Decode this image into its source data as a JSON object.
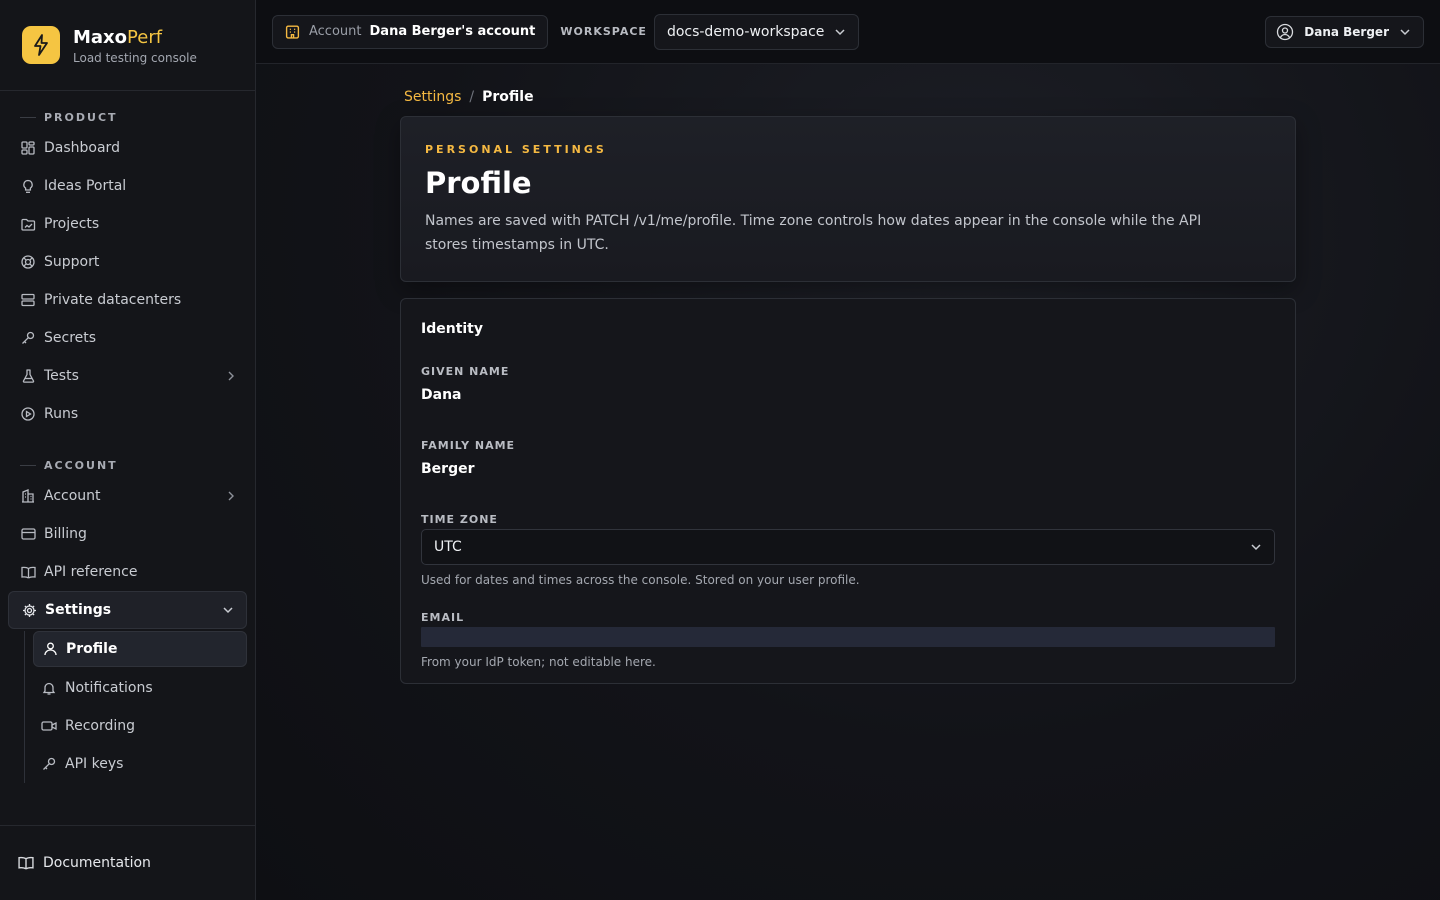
{
  "brand": {
    "name_main": "Maxo",
    "name_accent": "Perf",
    "subtitle": "Load testing console"
  },
  "sidebar": {
    "product_label": "PRODUCT",
    "product_items": [
      {
        "label": "Dashboard",
        "icon": "dashboard-icon"
      },
      {
        "label": "Ideas Portal",
        "icon": "lightbulb-icon"
      },
      {
        "label": "Projects",
        "icon": "folder-icon"
      },
      {
        "label": "Support",
        "icon": "lifebuoy-icon"
      },
      {
        "label": "Private datacenters",
        "icon": "server-icon"
      },
      {
        "label": "Secrets",
        "icon": "key-icon"
      },
      {
        "label": "Tests",
        "icon": "flask-icon"
      },
      {
        "label": "Runs",
        "icon": "play-circle-icon"
      }
    ],
    "account_label": "ACCOUNT",
    "account_items": [
      {
        "label": "Account",
        "icon": "building-icon"
      },
      {
        "label": "Billing",
        "icon": "credit-card-icon"
      },
      {
        "label": "API reference",
        "icon": "book-icon"
      },
      {
        "label": "Settings",
        "icon": "gear-icon"
      }
    ],
    "settings_subitems": [
      {
        "label": "Profile",
        "icon": "user-icon"
      },
      {
        "label": "Notifications",
        "icon": "bell-icon"
      },
      {
        "label": "Recording",
        "icon": "video-icon"
      },
      {
        "label": "API keys",
        "icon": "key-icon"
      }
    ],
    "footer_label": "Documentation"
  },
  "topbar": {
    "account_label": "Account",
    "account_value": "Dana Berger's account",
    "workspace_label": "WORKSPACE",
    "workspace_value": "docs-demo-workspace",
    "user_name": "Dana Berger"
  },
  "breadcrumb": {
    "parent": "Settings",
    "separator": "/",
    "current": "Profile"
  },
  "hero": {
    "eyebrow": "PERSONAL SETTINGS",
    "title": "Profile",
    "description": "Names are saved with PATCH /v1/me/profile. Time zone controls how dates appear in the console while the API stores timestamps in UTC."
  },
  "form": {
    "section_title": "Identity",
    "given_name_label": "GIVEN NAME",
    "given_name_value": "Dana",
    "family_name_label": "FAMILY NAME",
    "family_name_value": "Berger",
    "time_zone_label": "TIME ZONE",
    "time_zone_value": "UTC",
    "time_zone_help": "Used for dates and times across the console. Stored on your user profile.",
    "email_label": "EMAIL",
    "email_value": "",
    "email_help": "From your IdP token; not editable here."
  },
  "colors": {
    "accent": "#f5b942",
    "logo": "#f5c542",
    "background": "#0f1014"
  }
}
